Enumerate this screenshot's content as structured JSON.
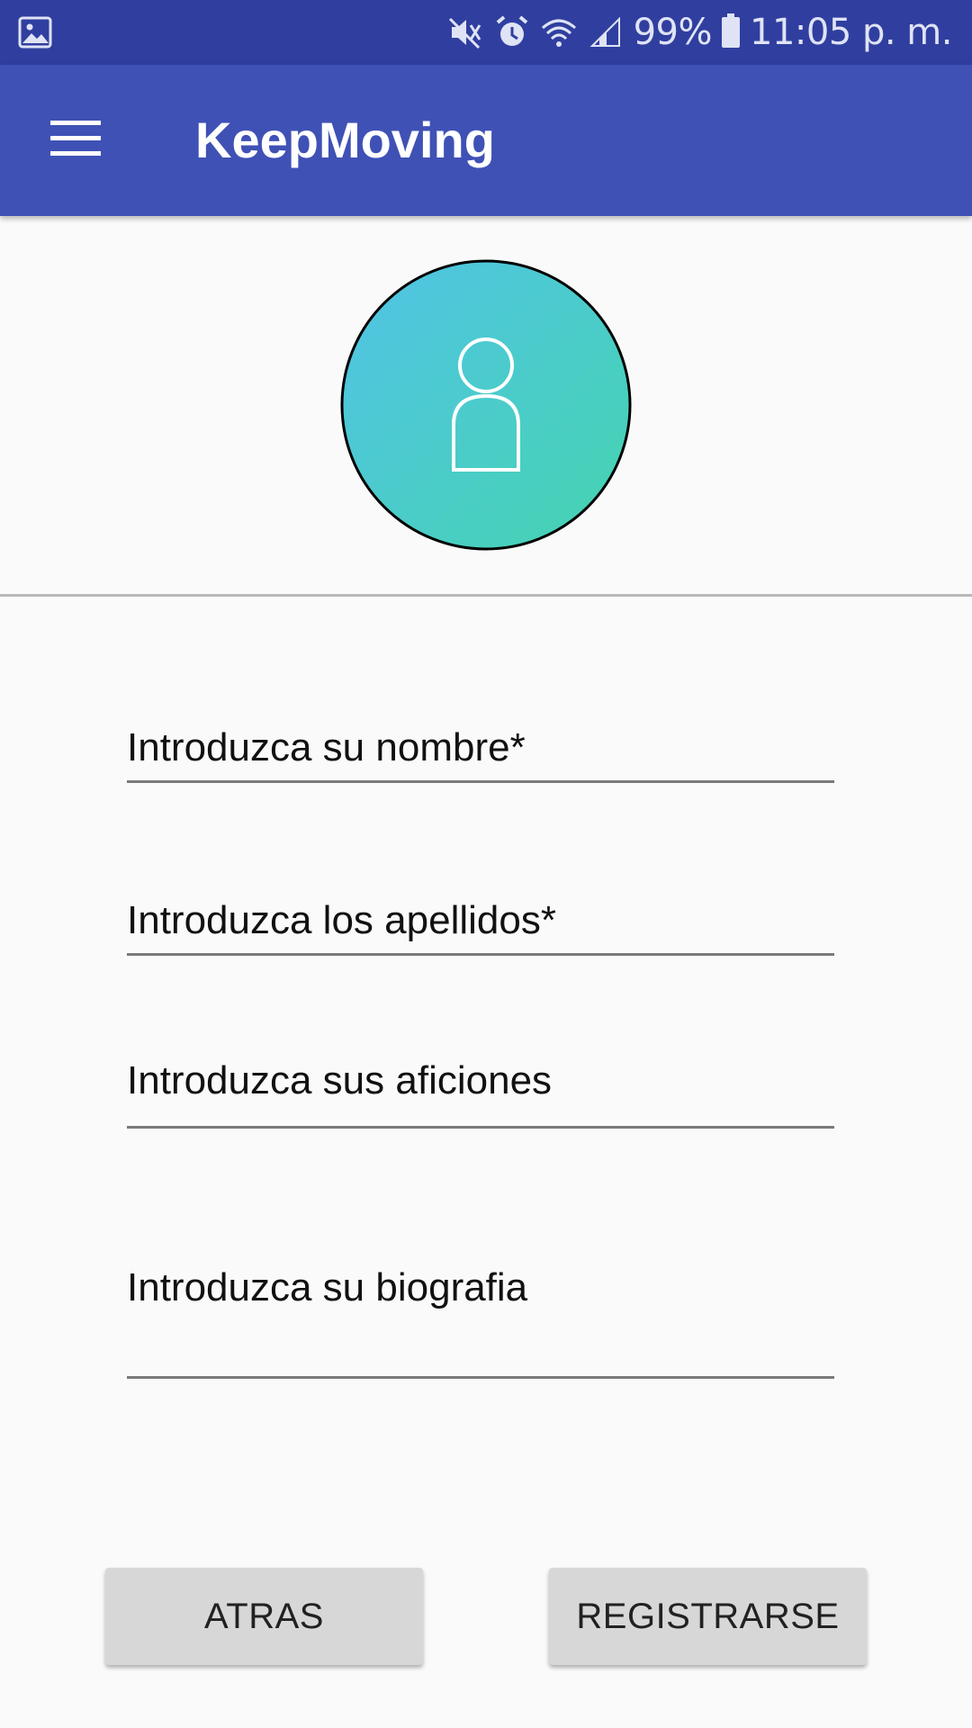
{
  "status_bar": {
    "left_icon": "gallery-icon",
    "icons": [
      "mute-icon",
      "alarm-icon",
      "wifi-icon",
      "signal-icon"
    ],
    "battery": "99%",
    "battery_icon": "battery-icon",
    "time": "11:05 p. m."
  },
  "app_bar": {
    "menu_icon": "menu-icon",
    "title": "KeepMoving",
    "color": "#3f51b5"
  },
  "avatar": {
    "icon": "person-icon",
    "gradient": [
      "#4fc3e0",
      "#47d1b5"
    ]
  },
  "form": {
    "name_placeholder": "Introduzca su nombre*",
    "surname_placeholder": "Introduzca los apellidos*",
    "hobbies_placeholder": "Introduzca sus aficiones",
    "bio_placeholder": "Introduzca su biografia"
  },
  "buttons": {
    "back_label": "ATRAS",
    "register_label": "REGISTRARSE"
  }
}
